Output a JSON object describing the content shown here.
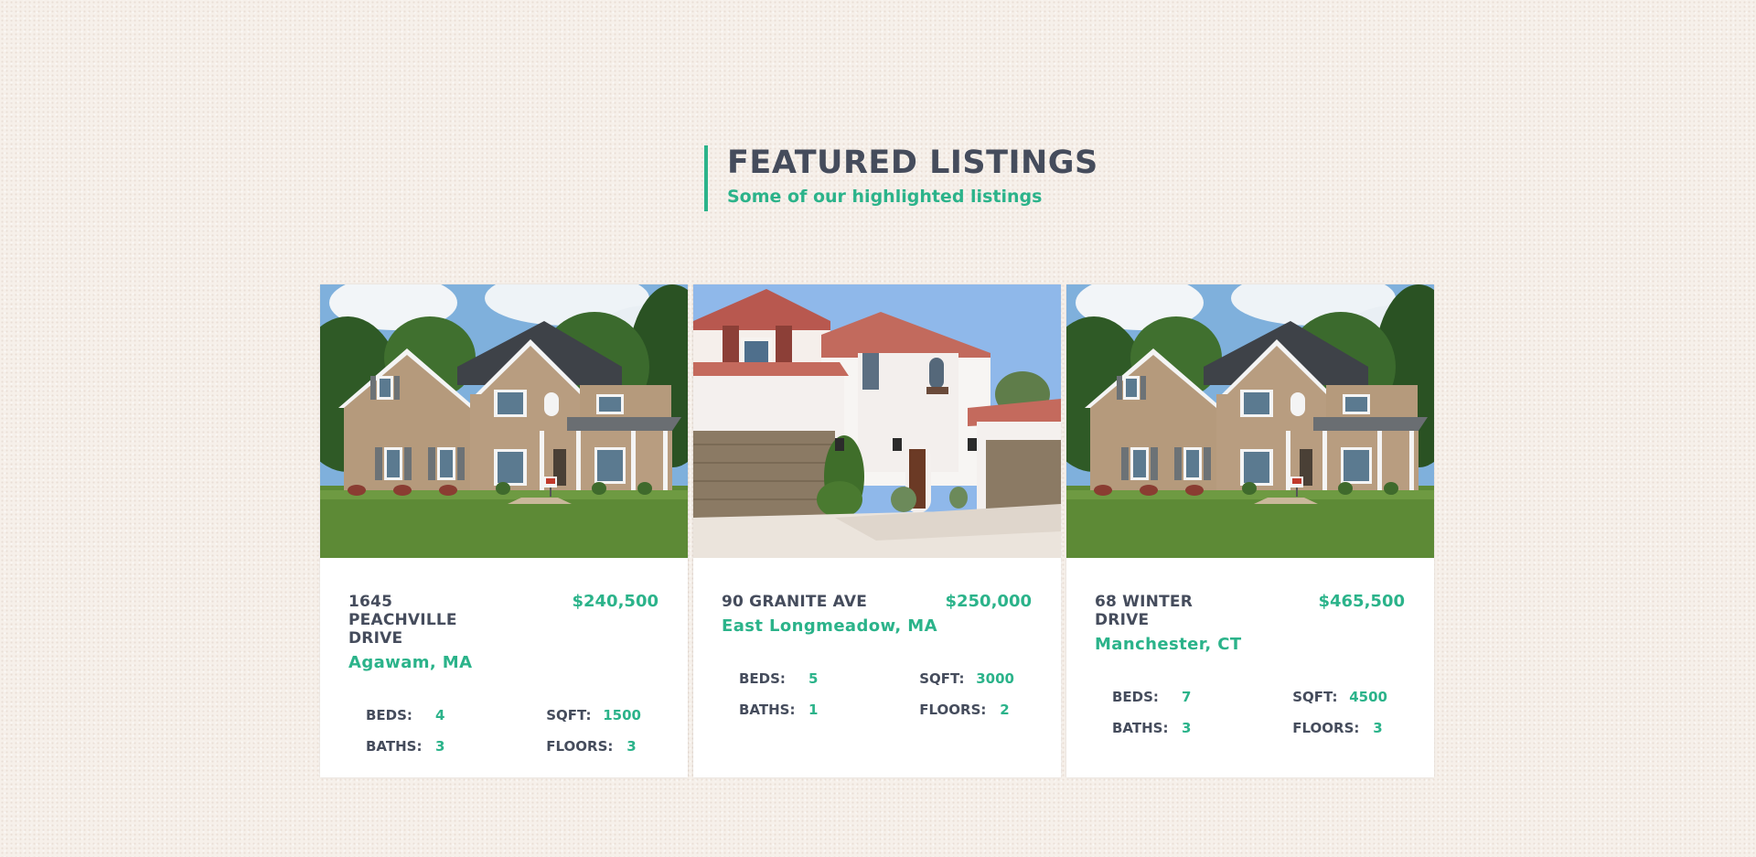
{
  "section": {
    "title": "FEATURED LISTINGS",
    "subtitle": "Some of our highlighted listings"
  },
  "stat_labels": {
    "beds": "BEDS:",
    "sqft": "SQFT:",
    "baths": "BATHS:",
    "floors": "FLOORS:"
  },
  "listings": [
    {
      "address": "1645 PEACHVILLE DRIVE",
      "price": "$240,500",
      "city": "Agawam, MA",
      "beds": "4",
      "sqft": "1500",
      "baths": "3",
      "floors": "3",
      "photo": "brick-house-photo"
    },
    {
      "address": "90 GRANITE AVE",
      "price": "$250,000",
      "city": "East Longmeadow, MA",
      "beds": "5",
      "sqft": "3000",
      "baths": "1",
      "floors": "2",
      "photo": "stucco-house-photo"
    },
    {
      "address": "68 WINTER DRIVE",
      "price": "$465,500",
      "city": "Manchester, CT",
      "beds": "7",
      "sqft": "4500",
      "baths": "3",
      "floors": "3",
      "photo": "brick-house-photo"
    }
  ],
  "colors": {
    "accent": "#2bb38a",
    "text_dark": "#454c5c",
    "background": "#f6f0ea"
  }
}
